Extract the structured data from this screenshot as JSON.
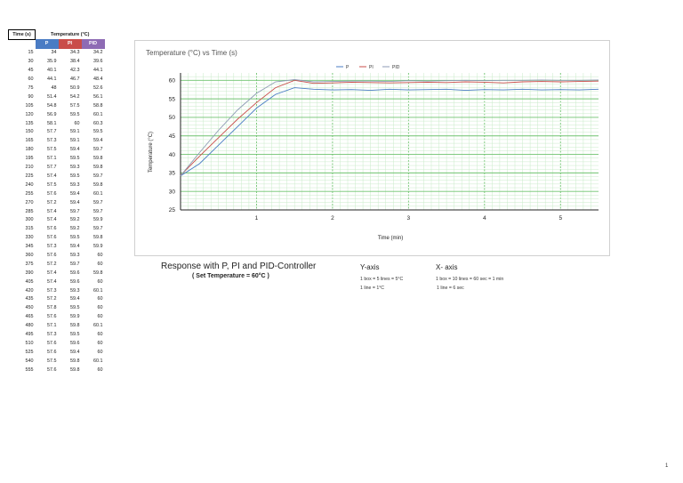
{
  "table": {
    "header_time": "Time (s)",
    "header_temperature": "Temperature (°C)",
    "sub_headers": [
      "P",
      "PI",
      "PID"
    ],
    "rows": [
      [
        "15",
        "34",
        "34.3",
        "34.2"
      ],
      [
        "30",
        "35.9",
        "38.4",
        "39.6"
      ],
      [
        "45",
        "40.1",
        "42.3",
        "44.1"
      ],
      [
        "60",
        "44.1",
        "46.7",
        "48.4"
      ],
      [
        "75",
        "48",
        "50.9",
        "52.6"
      ],
      [
        "90",
        "51.4",
        "54.2",
        "56.1"
      ],
      [
        "105",
        "54.8",
        "57.5",
        "58.8"
      ],
      [
        "120",
        "56.9",
        "59.5",
        "60.1"
      ],
      [
        "135",
        "58.1",
        "60",
        "60.3"
      ],
      [
        "150",
        "57.7",
        "59.1",
        "59.5"
      ],
      [
        "165",
        "57.3",
        "59.1",
        "59.4"
      ],
      [
        "180",
        "57.5",
        "59.4",
        "59.7"
      ],
      [
        "195",
        "57.1",
        "59.5",
        "59.8"
      ],
      [
        "210",
        "57.7",
        "59.3",
        "59.8"
      ],
      [
        "225",
        "57.4",
        "59.5",
        "59.7"
      ],
      [
        "240",
        "57.5",
        "59.3",
        "59.8"
      ],
      [
        "255",
        "57.6",
        "59.4",
        "60.1"
      ],
      [
        "270",
        "57.2",
        "59.4",
        "59.7"
      ],
      [
        "285",
        "57.4",
        "59.7",
        "59.7"
      ],
      [
        "300",
        "57.4",
        "59.2",
        "59.9"
      ],
      [
        "315",
        "57.6",
        "59.2",
        "59.7"
      ],
      [
        "330",
        "57.6",
        "59.5",
        "59.8"
      ],
      [
        "345",
        "57.3",
        "59.4",
        "59.9"
      ],
      [
        "360",
        "57.6",
        "59.3",
        "60"
      ],
      [
        "375",
        "57.2",
        "59.7",
        "60"
      ],
      [
        "390",
        "57.4",
        "59.6",
        "59.8"
      ],
      [
        "405",
        "57.4",
        "59.6",
        "60"
      ],
      [
        "420",
        "57.3",
        "59.3",
        "60.1"
      ],
      [
        "435",
        "57.2",
        "59.4",
        "60"
      ],
      [
        "450",
        "57.8",
        "59.5",
        "60"
      ],
      [
        "465",
        "57.6",
        "59.9",
        "60"
      ],
      [
        "480",
        "57.1",
        "59.8",
        "60.1"
      ],
      [
        "495",
        "57.3",
        "59.5",
        "60"
      ],
      [
        "510",
        "57.6",
        "59.6",
        "60"
      ],
      [
        "525",
        "57.6",
        "59.4",
        "60"
      ],
      [
        "540",
        "57.5",
        "59.8",
        "60.1"
      ],
      [
        "555",
        "57.6",
        "59.8",
        "60"
      ]
    ]
  },
  "chart_data": {
    "type": "line",
    "title": "Temperature (°C) vs Time (s)",
    "xlabel": "Time (min)",
    "ylabel": "Temperature (°C)",
    "xlim": [
      0,
      5.5
    ],
    "ylim": [
      25,
      62
    ],
    "x_ticks": [
      "1",
      "2",
      "3",
      "4",
      "5"
    ],
    "x_tick_values": [
      1,
      2,
      3,
      4,
      5
    ],
    "y_ticks": [
      "25",
      "30",
      "35",
      "40",
      "45",
      "50",
      "55",
      "60"
    ],
    "y_tick_values": [
      25,
      30,
      35,
      40,
      45,
      50,
      55,
      60
    ],
    "grid": true,
    "legend_placement": "top-center",
    "x": [
      0,
      0.25,
      0.5,
      0.75,
      1,
      1.25,
      1.5,
      1.75,
      2,
      2.25,
      2.5,
      2.75,
      3,
      3.25,
      3.5,
      3.75,
      4,
      4.25,
      4.5,
      4.75,
      5,
      5.25,
      5.5
    ],
    "series": [
      {
        "name": "P",
        "color": "#4a7cc4",
        "values": [
          34.2,
          37.5,
          42.5,
          47.5,
          52.5,
          56.2,
          58.0,
          57.6,
          57.4,
          57.5,
          57.3,
          57.6,
          57.4,
          57.5,
          57.6,
          57.3,
          57.5,
          57.4,
          57.6,
          57.4,
          57.5,
          57.4,
          57.6
        ]
      },
      {
        "name": "PI",
        "color": "#c94d4a",
        "values": [
          34.3,
          39.5,
          44.5,
          49.5,
          54.0,
          58.0,
          60.0,
          59.2,
          59.3,
          59.5,
          59.4,
          59.3,
          59.4,
          59.5,
          59.4,
          59.6,
          59.5,
          59.3,
          59.6,
          59.7,
          59.6,
          59.7,
          59.8
        ]
      },
      {
        "name": "PID",
        "color": "#8e9bb4",
        "values": [
          34.2,
          40.5,
          46.5,
          52.0,
          56.5,
          59.6,
          60.2,
          59.6,
          59.7,
          59.8,
          59.8,
          59.7,
          59.9,
          59.8,
          59.9,
          60.0,
          59.9,
          60.0,
          60.0,
          60.1,
          60.0,
          60.0,
          60.1
        ]
      }
    ]
  },
  "captions": {
    "title": "Response with P,  PI and PID-Controller",
    "subtitle": "( Set Temperature = 60°C )",
    "y_axis_heading": "Y-axis",
    "x_axis_heading": "X- axis",
    "y_note_1": "1 box = 5 lines = 5°C",
    "y_note_2": "1 line = 1°C",
    "x_note_1": "1 box = 10 lines = 60 sec = 1 min",
    "x_note_2": "1 line = 6 sec"
  },
  "page_number": "1"
}
